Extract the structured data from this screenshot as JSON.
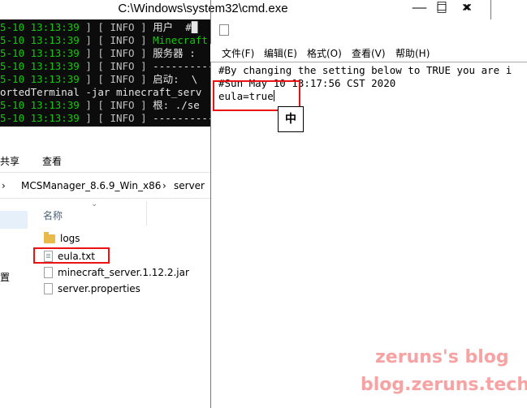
{
  "cmd": {
    "title": "C:\\Windows\\system32\\cmd.exe",
    "lines": [
      {
        "ts": "5-10 13:13:39",
        "pre": " ] [ ",
        "lvl": "INFO",
        "post": " ] ",
        "msg": "用户  #█",
        "green": false
      },
      {
        "ts": "5-10 13:13:39",
        "pre": " ] [ ",
        "lvl": "INFO",
        "post": " ] ",
        "msg": "Minecraft Serve",
        "green": true
      },
      {
        "ts": "5-10 13:13:39",
        "pre": " ] [ ",
        "lvl": "INFO",
        "post": " ] ",
        "msg": "服务器 :",
        "green": false
      },
      {
        "ts": "5-10 13:13:39",
        "pre": " ] [ ",
        "lvl": "INFO",
        "post": " ] ",
        "msg": "----------",
        "green": false
      },
      {
        "ts": "5-10 13:13:39",
        "pre": " ] [ ",
        "lvl": "INFO",
        "post": " ] ",
        "msg": "启动:  \\",
        "green": false
      },
      {
        "ts": "",
        "pre": "",
        "lvl": "",
        "post": "",
        "msg": "ortedTerminal -jar minecraft_serv",
        "green": false
      },
      {
        "ts": "5-10 13:13:39",
        "pre": " ] [ ",
        "lvl": "INFO",
        "post": " ] ",
        "msg": "根: ./se",
        "green": false
      },
      {
        "ts": "5-10 13:13:39",
        "pre": " ] [ ",
        "lvl": "INFO",
        "post": " ] ",
        "msg": "----------",
        "green": false
      }
    ],
    "controls": {
      "minimize": "—",
      "maximize": "□",
      "close": "✕"
    }
  },
  "explorer": {
    "ribbon": {
      "share": "共享",
      "view": "查看"
    },
    "breadcrumb": {
      "sep": "›",
      "path1": "MCSManager_8.6.9_Win_x86",
      "path2": "server",
      "chevron": "⌄"
    },
    "column_name": "名称",
    "nav_label": "置",
    "files": [
      {
        "name": "logs",
        "type": "folder"
      },
      {
        "name": "eula.txt",
        "type": "txt"
      },
      {
        "name": "minecraft_server.1.12.2.jar",
        "type": "file"
      },
      {
        "name": "server.properties",
        "type": "file"
      }
    ]
  },
  "notepad": {
    "menu": [
      "文件(F)",
      "编辑(E)",
      "格式(O)",
      "查看(V)",
      "帮助(H)"
    ],
    "lines": [
      "#By changing the setting below to TRUE you are i",
      "#Sun May 10 13:17:56 CST 2020",
      "eula=true"
    ],
    "ime_label": "中"
  },
  "watermark": {
    "line1": "zeruns's blog",
    "line2": "blog.zeruns.tech"
  },
  "colors": {
    "highlight": "#e11111",
    "watermark": "#f7a3a3",
    "console_green": "#16c60c"
  }
}
